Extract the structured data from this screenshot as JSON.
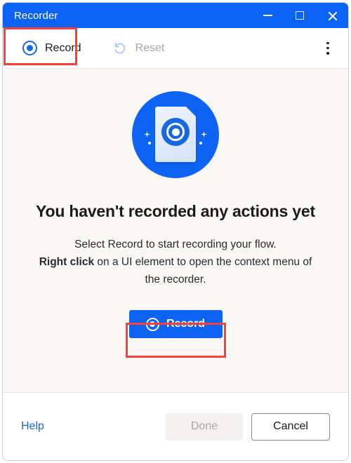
{
  "window": {
    "title": "Recorder",
    "controls": {
      "minimize": "minimize-icon",
      "maximize": "maximize-icon",
      "close": "close-icon"
    }
  },
  "toolbar": {
    "record_label": "Record",
    "record_icon": "record-circle-icon",
    "reset_label": "Reset",
    "reset_icon": "undo-arrow-icon",
    "reset_disabled": true,
    "overflow_icon": "more-vertical-icon"
  },
  "content": {
    "illustration_icon": "document-record-illustration",
    "title": "You haven't recorded any actions yet",
    "body_line1": "Select Record to start recording your flow.",
    "body_bold": "Right click",
    "body_line2_rest": " on a UI element to open the context menu of the recorder.",
    "record_button_label": "Record",
    "record_button_icon": "record-circle-icon"
  },
  "footer": {
    "help_label": "Help",
    "done_label": "Done",
    "done_disabled": true,
    "cancel_label": "Cancel"
  },
  "colors": {
    "titlebar_blue": "#0b63f6",
    "accent_blue": "#0d63f3",
    "icon_blue": "#1767e0",
    "content_bg": "#f9f8f7",
    "annotation_red": "#f8413b",
    "disabled_text": "#a7a7a7"
  },
  "annotations": [
    {
      "name": "toolbar-record-highlight",
      "target": "toolbar Record command"
    },
    {
      "name": "primary-record-highlight",
      "target": "main Record button"
    }
  ]
}
